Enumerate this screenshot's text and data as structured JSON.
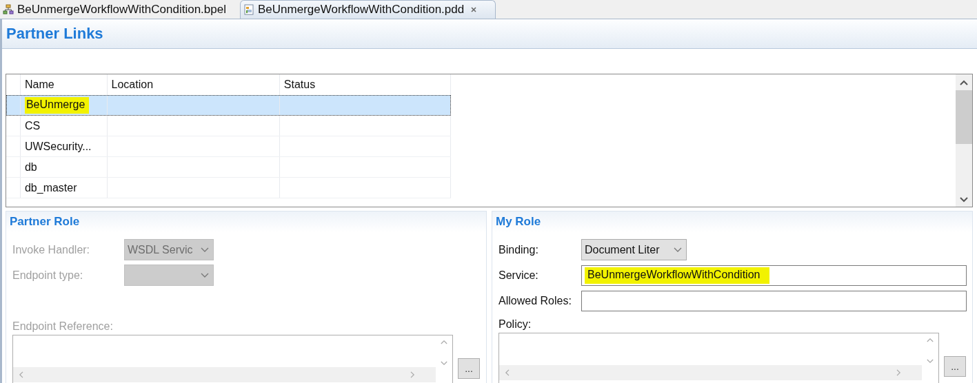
{
  "tabs": [
    {
      "label": "BeUnmergeWorkflowWithCondition.bpel",
      "selected": false,
      "closable": false
    },
    {
      "label": "BeUnmergeWorkflowWithCondition.pdd",
      "selected": true,
      "closable": true
    }
  ],
  "page_title": "Partner Links",
  "table": {
    "columns": [
      "Name",
      "Location",
      "Status"
    ],
    "rows": [
      {
        "name": "BeUnmerge",
        "selected": true,
        "highlighted": true
      },
      {
        "name": "CS",
        "selected": false,
        "highlighted": false
      },
      {
        "name": "UWSecurity...",
        "selected": false,
        "highlighted": false
      },
      {
        "name": "db",
        "selected": false,
        "highlighted": false
      },
      {
        "name": "db_master",
        "selected": false,
        "highlighted": false
      }
    ]
  },
  "partner_role": {
    "title": "Partner Role",
    "disabled": true,
    "fields": [
      {
        "kind": "dropdown",
        "label": "Invoke Handler:",
        "value": "WSDL Servic"
      },
      {
        "kind": "dropdown",
        "label": "Endpoint type:"
      }
    ],
    "area": {
      "label": "Endpoint Reference:",
      "button": "..."
    }
  },
  "my_role": {
    "title": "My Role",
    "disabled": false,
    "fields": [
      {
        "kind": "dropdown",
        "label": "Binding:",
        "value": "Document Liter"
      },
      {
        "kind": "text",
        "label": "Service:",
        "value": "BeUnmergeWorkflowWithCondition",
        "highlighted": true
      },
      {
        "kind": "text",
        "label": "Allowed Roles:"
      }
    ],
    "area": {
      "label": "Policy:",
      "button": "..."
    }
  }
}
